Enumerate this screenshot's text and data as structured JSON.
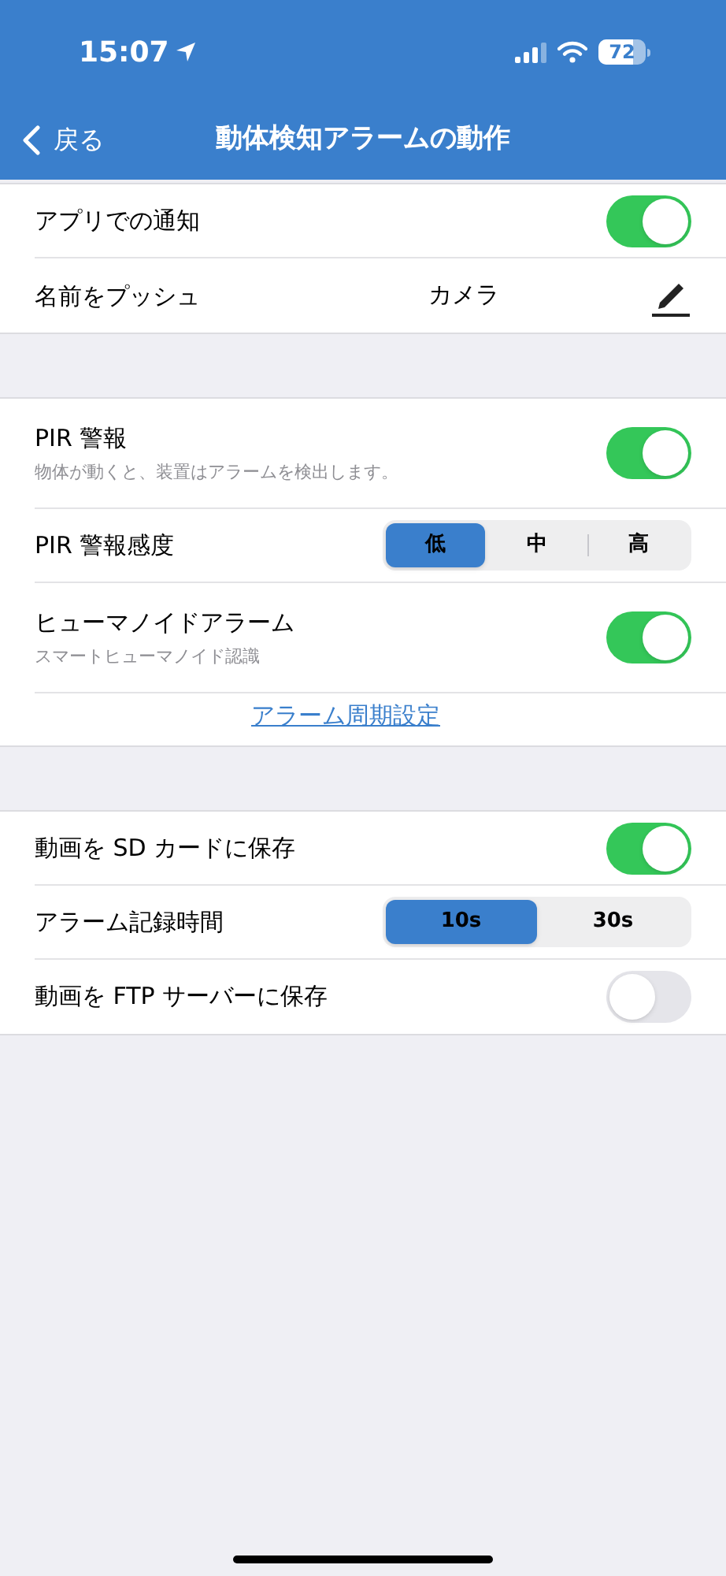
{
  "status_bar": {
    "time": "15:07",
    "battery": "72"
  },
  "nav": {
    "back": "戻る",
    "title": "動体検知アラームの動作"
  },
  "sections": [
    {
      "rows": [
        {
          "kind": "toggle",
          "label": "アプリでの通知",
          "on": true
        },
        {
          "kind": "edit",
          "label": "名前をプッシュ",
          "value": "カメラ"
        }
      ]
    },
    {
      "rows": [
        {
          "kind": "toggle",
          "label": "PIR 警報",
          "subtitle": "物体が動くと、装置はアラームを検出します。",
          "on": true
        },
        {
          "kind": "segmented",
          "label": "PIR 警報感度",
          "options": [
            {
              "label": "低",
              "selected": true
            },
            {
              "label": "中",
              "selected": false
            },
            {
              "label": "高",
              "selected": false
            }
          ]
        },
        {
          "kind": "toggle",
          "label": "ヒューマノイドアラーム",
          "subtitle": "スマートヒューマノイド認識",
          "on": true
        },
        {
          "kind": "link",
          "label": "アラーム周期設定"
        }
      ]
    },
    {
      "rows": [
        {
          "kind": "toggle",
          "label": "動画を SD カードに保存",
          "on": true
        },
        {
          "kind": "segmented",
          "label": "アラーム記録時間",
          "options": [
            {
              "label": "10s",
              "selected": true
            },
            {
              "label": "30s",
              "selected": false
            }
          ]
        },
        {
          "kind": "toggle",
          "label": "動画を FTP サーバーに保存",
          "on": false
        }
      ]
    }
  ]
}
